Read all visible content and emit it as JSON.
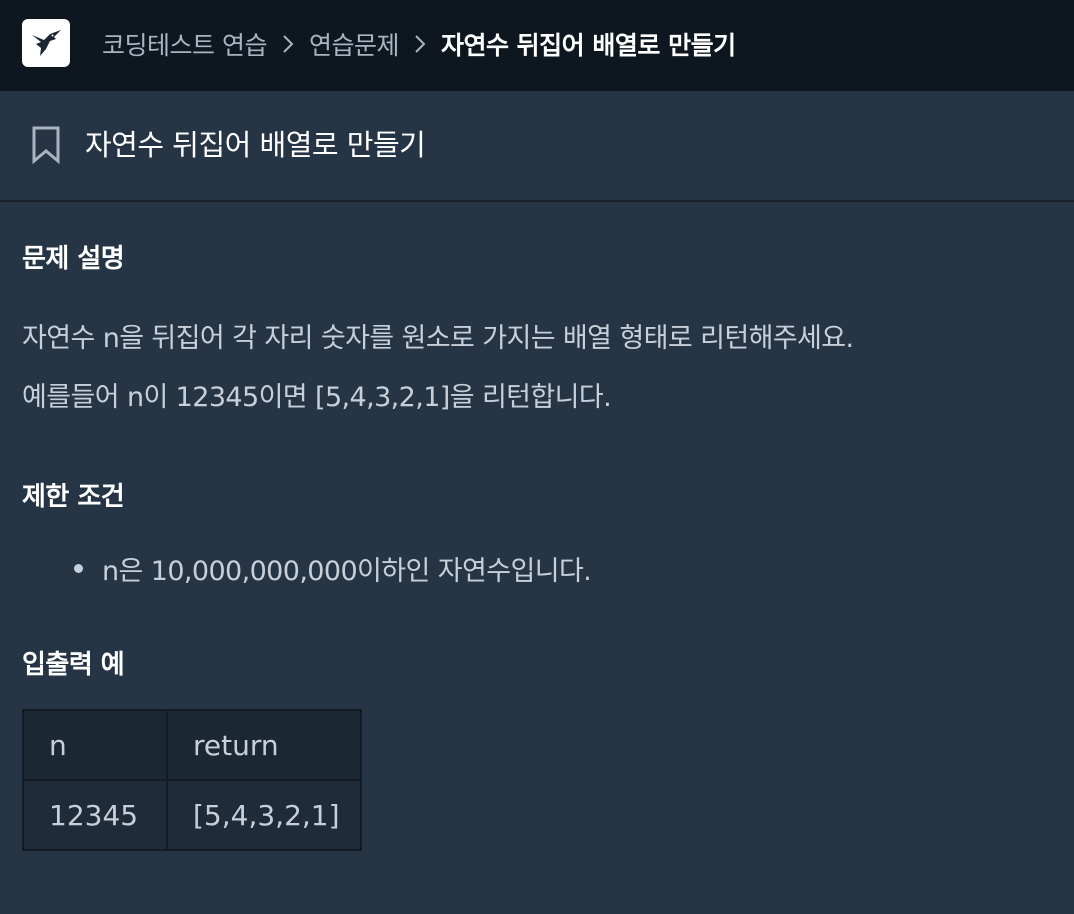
{
  "header": {
    "logo_icon": "hummingbird-logo-icon",
    "breadcrumbs": [
      {
        "label": "코딩테스트 연습"
      },
      {
        "label": "연습문제"
      },
      {
        "label": "자연수 뒤집어 배열로 만들기"
      }
    ]
  },
  "problem": {
    "bookmark_icon": "bookmark-icon",
    "title": "자연수 뒤집어 배열로 만들기",
    "description_heading": "문제 설명",
    "description_lines": [
      "자연수 n을 뒤집어 각 자리 숫자를 원소로 가지는 배열 형태로 리턴해주세요.",
      "예를들어 n이 12345이면 [5,4,3,2,1]을 리턴합니다."
    ],
    "constraints_heading": "제한 조건",
    "constraints": [
      "n은 10,000,000,000이하인 자연수입니다."
    ],
    "examples_heading": "입출력 예",
    "examples_table": {
      "headers": [
        "n",
        "return"
      ],
      "rows": [
        [
          "12345",
          "[5,4,3,2,1]"
        ]
      ]
    }
  },
  "colors": {
    "background": "#263545",
    "topbar": "#0e171f",
    "text": "#c7d0da",
    "heading": "#ffffff"
  }
}
